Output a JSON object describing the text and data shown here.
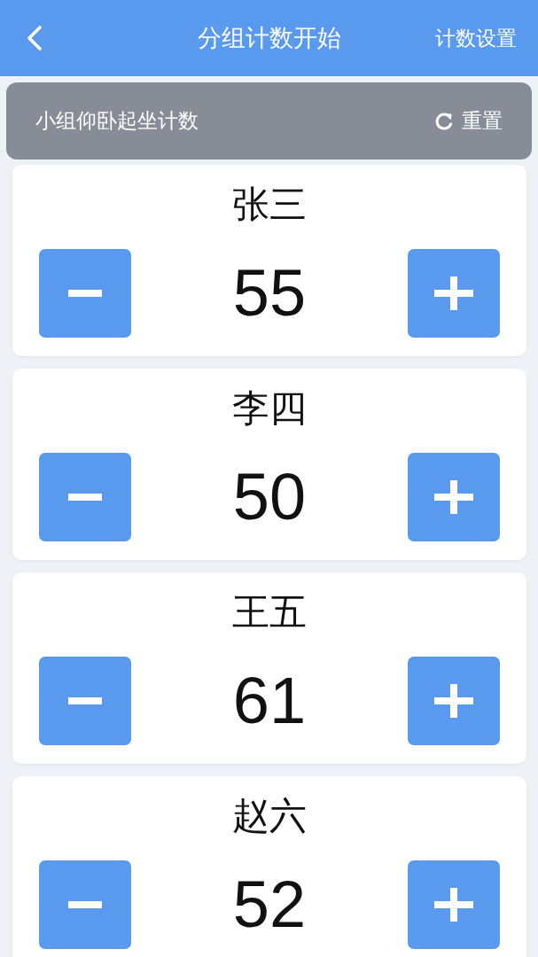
{
  "header": {
    "title": "分组计数开始",
    "action": "计数设置"
  },
  "group_bar": {
    "title": "小组仰卧起坐计数",
    "reset_label": "重置"
  },
  "counters": [
    {
      "name": "张三",
      "count": "55"
    },
    {
      "name": "李四",
      "count": "50"
    },
    {
      "name": "王五",
      "count": "61"
    },
    {
      "name": "赵六",
      "count": "52"
    }
  ]
}
